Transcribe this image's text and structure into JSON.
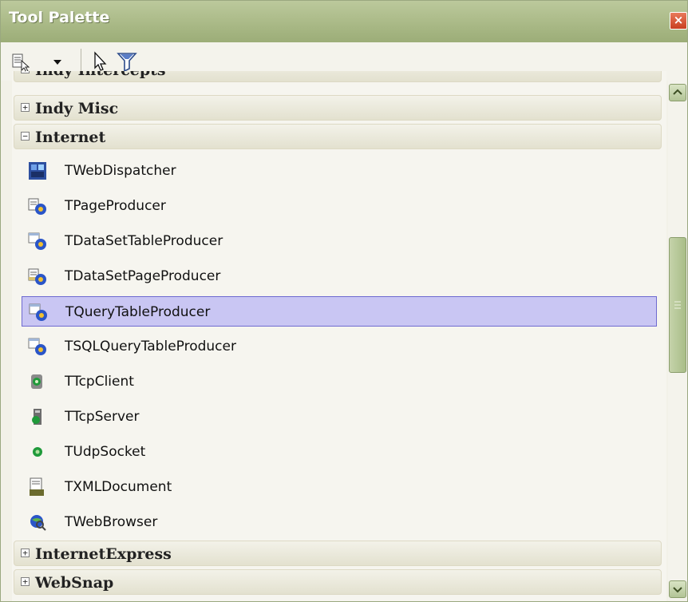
{
  "window": {
    "title": "Tool Palette",
    "close_label": "×"
  },
  "toolbar": {
    "items": [
      {
        "icon": "palette-list-icon"
      },
      {
        "icon": "dropdown-arrow-icon"
      },
      {
        "icon": "pointer-icon"
      },
      {
        "icon": "filter-icon"
      }
    ]
  },
  "categories": {
    "indy_intercepts": {
      "label": "Indy Intercepts",
      "state": "+"
    },
    "indy_misc": {
      "label": "Indy Misc",
      "state": "+"
    },
    "internet": {
      "label": "Internet",
      "state": "−"
    },
    "internet_express": {
      "label": "InternetExpress",
      "state": "+"
    },
    "websnap": {
      "label": "WebSnap",
      "state": "+"
    }
  },
  "items": [
    {
      "label": "TWebDispatcher",
      "icon": "web-dispatcher-icon"
    },
    {
      "label": "TPageProducer",
      "icon": "page-producer-icon"
    },
    {
      "label": "TDataSetTableProducer",
      "icon": "dataset-table-producer-icon"
    },
    {
      "label": "TDataSetPageProducer",
      "icon": "dataset-page-producer-icon"
    },
    {
      "label": "TQueryTableProducer",
      "icon": "query-table-producer-icon",
      "selected": true
    },
    {
      "label": "TSQLQueryTableProducer",
      "icon": "sql-query-table-producer-icon"
    },
    {
      "label": "TTcpClient",
      "icon": "tcp-client-icon"
    },
    {
      "label": "TTcpServer",
      "icon": "tcp-server-icon"
    },
    {
      "label": "TUdpSocket",
      "icon": "udp-socket-icon"
    },
    {
      "label": "TXMLDocument",
      "icon": "xml-document-icon"
    },
    {
      "label": "TWebBrowser",
      "icon": "web-browser-icon"
    }
  ],
  "colors": {
    "selection": "#c9c6f3",
    "titlebar": "#a8b885"
  }
}
